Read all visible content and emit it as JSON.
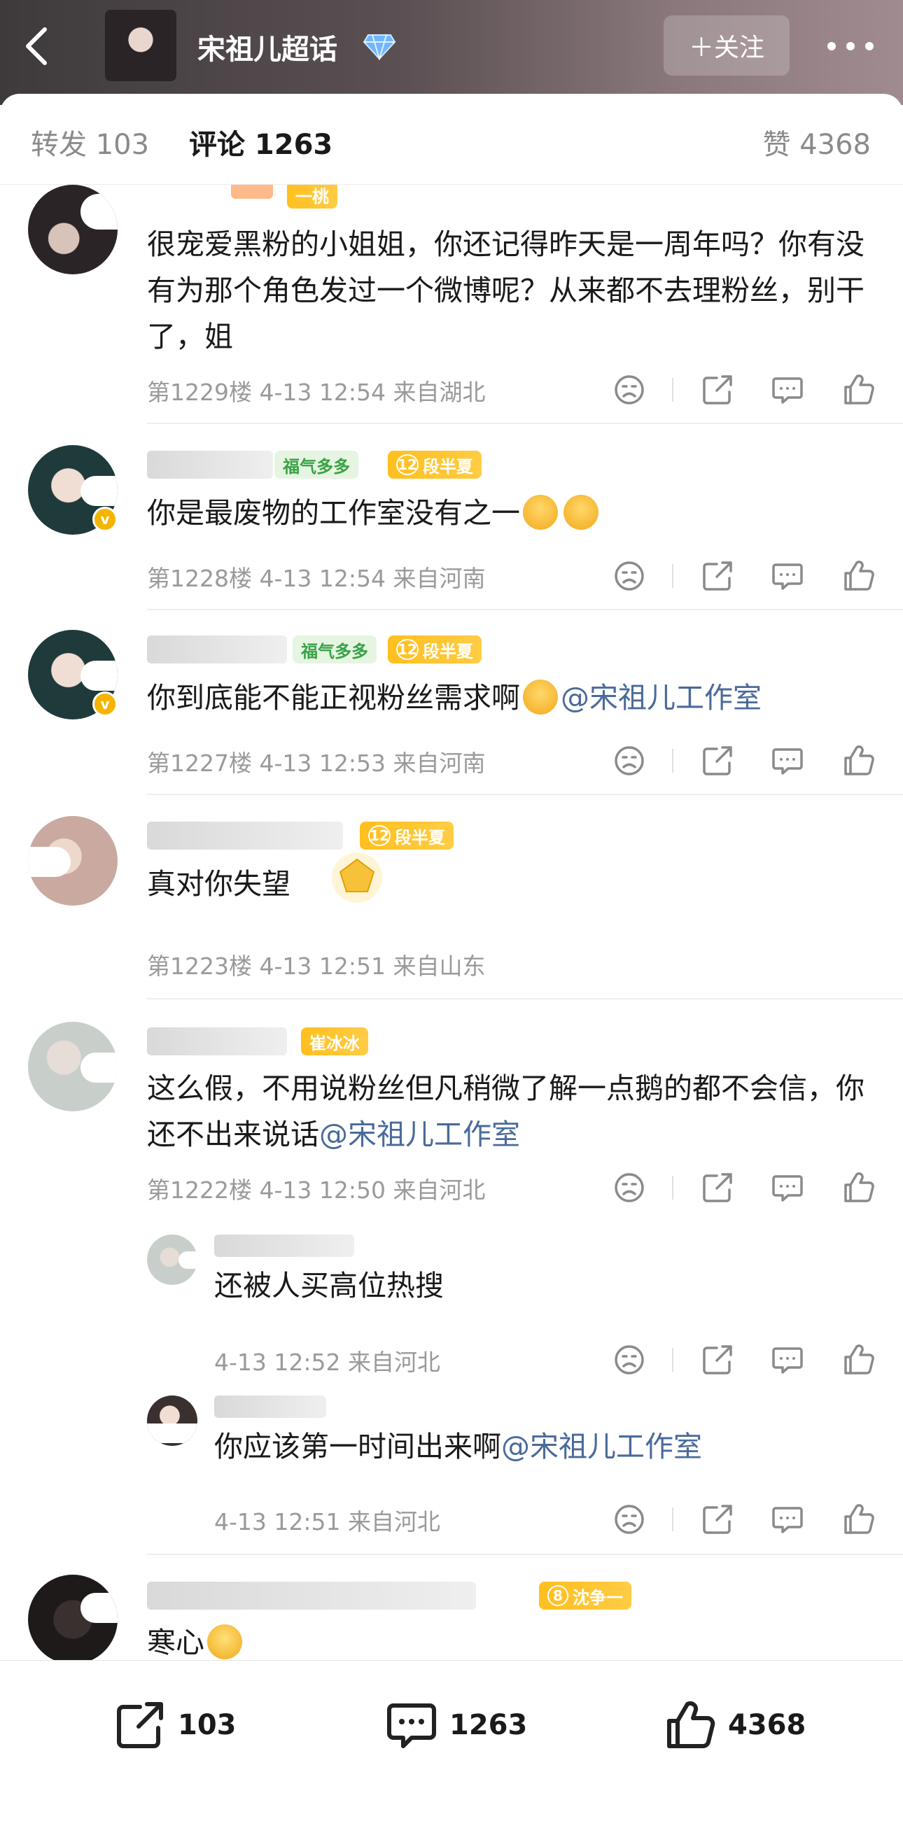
{
  "header": {
    "title": "宋祖儿超话",
    "follow_label": "＋关注"
  },
  "tabs": {
    "repost": "转发 103",
    "comment": "评论 1263",
    "like": "赞 4368"
  },
  "comments": [
    {
      "badges": [
        "一桃"
      ],
      "text": "很宠爱黑粉的小姐姐，你还记得昨天是一周年吗？你有没有为那个角色发过一个微博呢？从来都不去理粉丝，别干了，姐",
      "meta": "第1229楼 4-13 12:54 来自湖北"
    },
    {
      "badges": [
        "福气多多",
        "段半夏"
      ],
      "level": "12",
      "text": "你是最废物的工作室没有之一",
      "meta": "第1228楼 4-13 12:54 来自河南"
    },
    {
      "badges": [
        "福气多多",
        "段半夏"
      ],
      "level": "12",
      "text": "你到底能不能正视粉丝需求啊",
      "mention": "@宋祖儿工作室",
      "meta": "第1227楼 4-13 12:53 来自河南"
    },
    {
      "badges": [
        "段半夏"
      ],
      "level": "12",
      "text": "真对你失望",
      "meta": "第1223楼 4-13 12:51 来自山东"
    },
    {
      "badges": [
        "崔冰冰"
      ],
      "text": "这么假，不用说粉丝但凡稍微了解一点鹅的都不会信，你还不出来说话",
      "mention": "@宋祖儿工作室",
      "meta": "第1222楼 4-13 12:50 来自河北"
    },
    {
      "reply": true,
      "text": "还被人买高位热搜",
      "meta": "4-13 12:52 来自河北"
    },
    {
      "reply": true,
      "text": "你应该第一时间出来啊",
      "mention": "@宋祖儿工作室",
      "meta": "4-13 12:51 来自河北"
    },
    {
      "badges": [
        "沈争一"
      ],
      "level": "8",
      "text": "寒心"
    }
  ],
  "bottom": {
    "repost_count": "103",
    "comment_count": "1263",
    "like_count": "4368"
  },
  "icons": {
    "back": "chevron-left-icon",
    "more": "more-dots-icon",
    "dislike": "sad-face-icon",
    "share": "share-icon",
    "reply": "comment-icon",
    "like": "thumbs-up-icon"
  },
  "colors": {
    "mention": "#4a6a9a",
    "badge_gold": "#ffbf1f",
    "badge_green": "#3aa245"
  }
}
